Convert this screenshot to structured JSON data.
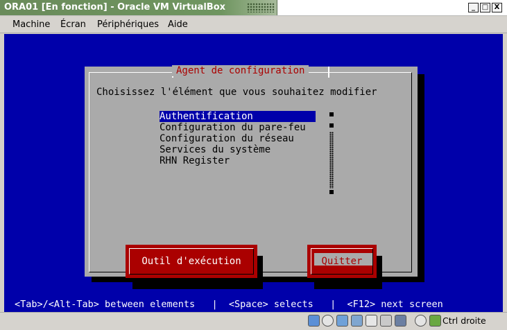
{
  "window": {
    "title": "ORA01 [En fonction] - Oracle VM VirtualBox",
    "buttons": {
      "minimize": "_",
      "maximize": "□",
      "close": "X"
    }
  },
  "menubar": {
    "items": [
      "Machine",
      "Écran",
      "Périphériques",
      "Aide"
    ]
  },
  "vm": {
    "dialog": {
      "title": "Agent de configuration",
      "prompt": "Choisissez l'élément que vous souhaitez modifier",
      "items": [
        "Authentification",
        "Configuration du pare-feu",
        "Configuration du réseau",
        "Services du système",
        "RHN Register"
      ],
      "selected_index": 0,
      "buttons": {
        "run_tool": "Outil d'exécution",
        "quit": "Quitter"
      }
    },
    "hint": "<Tab>/<Alt-Tab> between elements   |  <Space> selects   |  <F12> next screen",
    "colors": {
      "background": "#0000aa",
      "dialog": "#aaaaaa",
      "title": "#aa0000",
      "button": "#aa0000"
    }
  },
  "statusbar": {
    "host_key": "Ctrl droite",
    "icons": [
      "hard-disk-icon",
      "optical-drive-icon",
      "usb-icon",
      "network-icon",
      "shared-folders-icon",
      "display-icon",
      "video-capture-icon",
      "recording-icon",
      "mouse-integration-icon",
      "keyboard-icon"
    ]
  }
}
